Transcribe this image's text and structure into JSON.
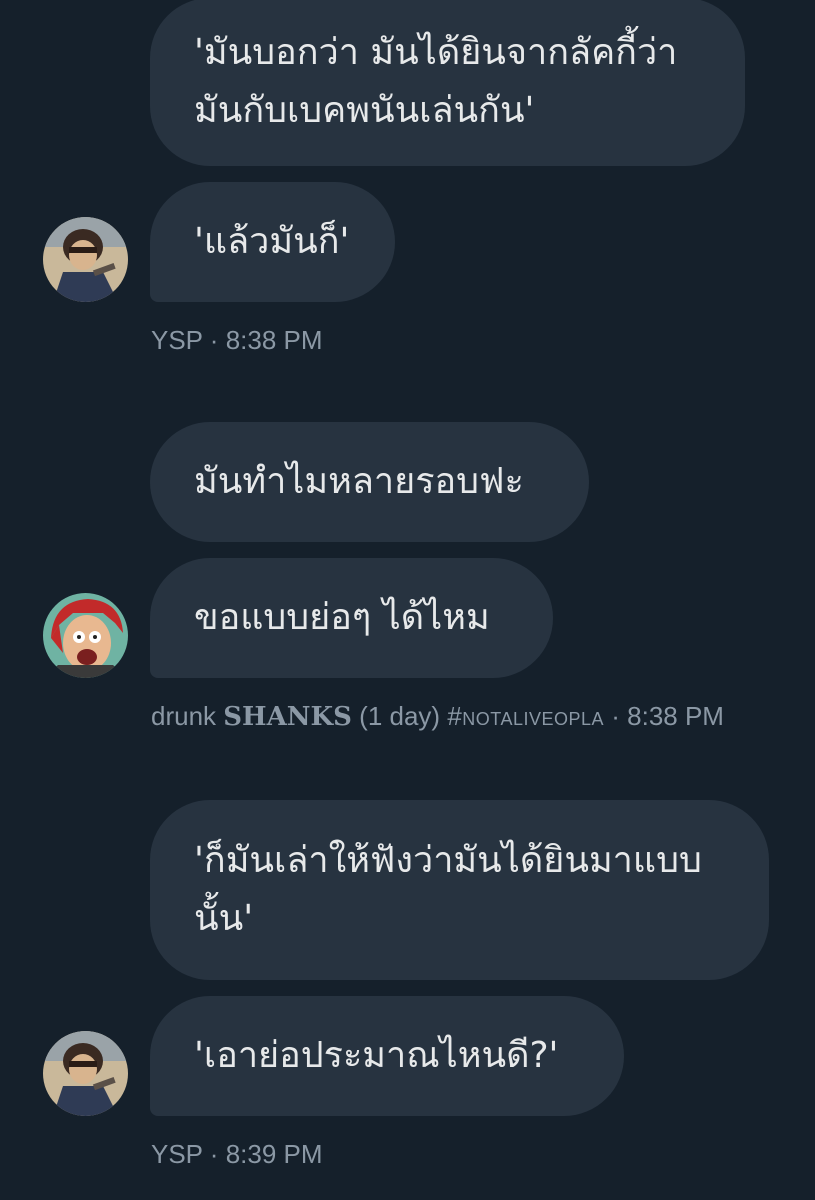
{
  "colors": {
    "background": "#15202b",
    "bubble": "#273340",
    "text": "#e7e9ea",
    "meta": "#8b98a5"
  },
  "groups": [
    {
      "messages": [
        "'มันบอกว่า มันได้ยินจากลัคกี้ว่า มันกับเบคพนันเล่นกัน'",
        "'แล้วมันก็'"
      ],
      "avatar": "ysp-avatar",
      "meta": {
        "name": "YSP",
        "separator": "·",
        "time": "8:38 PM"
      }
    },
    {
      "messages": [
        "มันทำไมหลายรอบฟะ",
        "ขอแบบย่อๆ ได้ไหม"
      ],
      "avatar": "shanks-avatar",
      "meta": {
        "name_prefix": "drunk",
        "name_bold": "SHANKS",
        "name_suffix": "(1 day)",
        "tag": "#notaliveopla",
        "separator": "·",
        "time": "8:38 PM"
      }
    },
    {
      "messages": [
        "'ก็มันเล่าให้ฟังว่ามันได้ยินมาแบบ นั้น'",
        "'เอาย่อประมาณไหนดี?'"
      ],
      "avatar": "ysp-avatar",
      "meta": {
        "name": "YSP",
        "separator": "·",
        "time": "8:39 PM"
      }
    }
  ]
}
